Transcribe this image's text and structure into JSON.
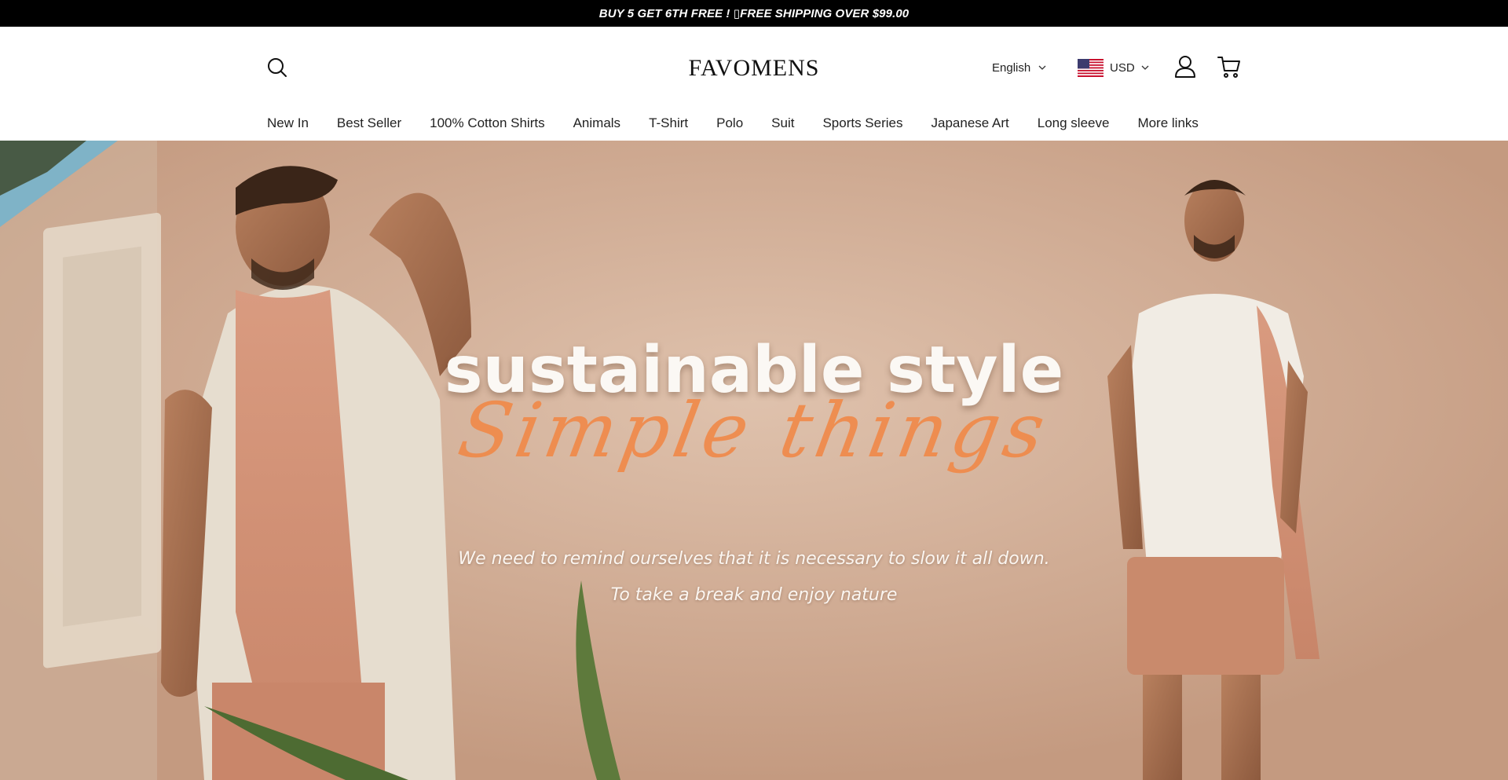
{
  "announcement": {
    "text": "BUY 5 GET 6TH FREE ! ▯FREE SHIPPING OVER $99.00"
  },
  "header": {
    "logo": "FAVOMENS",
    "language": "English",
    "currency": "USD",
    "icons": {
      "search": "search-icon",
      "account": "user-icon",
      "cart": "cart-icon",
      "flag": "us-flag-icon"
    }
  },
  "nav": {
    "items": [
      {
        "label": "New In"
      },
      {
        "label": "Best Seller"
      },
      {
        "label": "100% Cotton Shirts"
      },
      {
        "label": "Animals"
      },
      {
        "label": "T-Shirt"
      },
      {
        "label": "Polo"
      },
      {
        "label": "Suit"
      },
      {
        "label": "Sports Series"
      },
      {
        "label": "Japanese Art"
      },
      {
        "label": "Long sleeve"
      },
      {
        "label": "More links"
      }
    ]
  },
  "hero": {
    "headline": "sustainable style",
    "script": "Simple things",
    "subtitle_line1": "We need to remind ourselves that it is necessary to slow it all down.",
    "subtitle_line2": "To take a break and enjoy nature"
  },
  "colors": {
    "announcement_bg": "#000000",
    "script_accent": "#f08a4a",
    "hero_bg": "#d3ad94"
  }
}
